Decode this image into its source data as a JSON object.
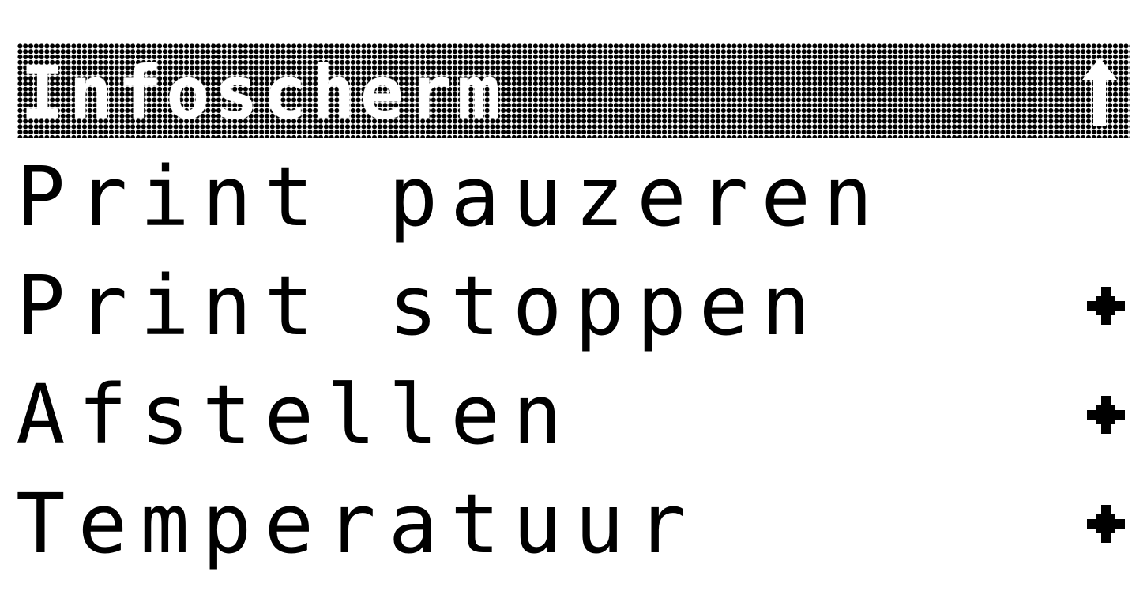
{
  "header": {
    "title": "Infoscherm",
    "back_icon": "up-arrow-icon"
  },
  "menu": {
    "items": [
      {
        "label": "Print pauzeren",
        "submenu": false
      },
      {
        "label": "Print stoppen",
        "submenu": true,
        "icon": "submenu-plus-icon"
      },
      {
        "label": "Afstellen",
        "submenu": true,
        "icon": "submenu-plus-icon"
      },
      {
        "label": "Temperatuur",
        "submenu": true,
        "icon": "submenu-plus-icon"
      }
    ]
  },
  "colors": {
    "foreground": "#000000",
    "background": "#ffffff"
  }
}
